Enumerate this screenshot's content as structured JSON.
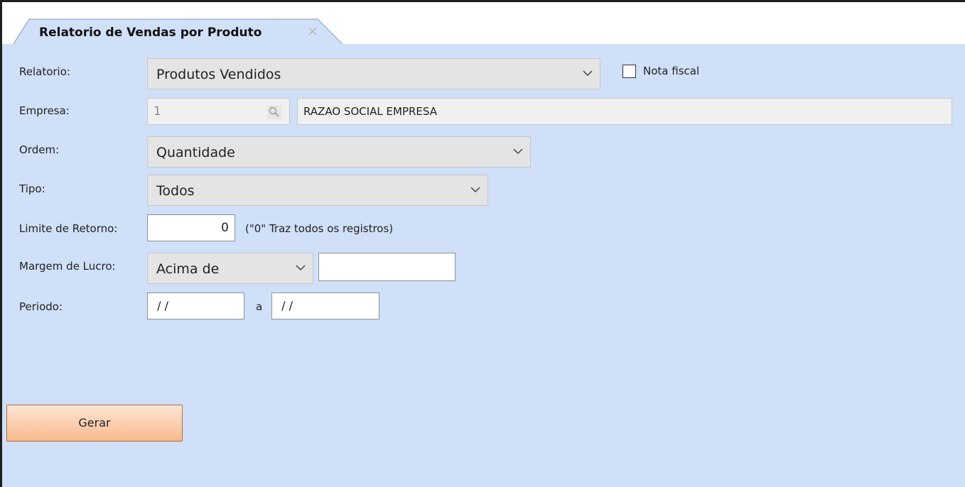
{
  "tab": {
    "title": "Relatorio de Vendas por Produto",
    "close": "×"
  },
  "form": {
    "relatorio": {
      "label": "Relatorio:",
      "value": "Produtos Vendidos"
    },
    "nota_fiscal": {
      "label": "Nota fiscal",
      "checked": false
    },
    "empresa": {
      "label": "Empresa:",
      "code": "1",
      "name": "RAZAO SOCIAL EMPRESA"
    },
    "ordem": {
      "label": "Ordem:",
      "value": "Quantidade"
    },
    "tipo": {
      "label": "Tipo:",
      "value": "Todos"
    },
    "limite": {
      "label": "Limite de Retorno:",
      "value": "0",
      "hint": "(\"0\" Traz todos os registros)"
    },
    "margem": {
      "label": "Margem de Lucro:",
      "value": "Acima de",
      "amount": ""
    },
    "periodo": {
      "label": "Periodo:",
      "start": " / /",
      "separator": "a",
      "end": " / /"
    }
  },
  "actions": {
    "gerar": "Gerar"
  },
  "colors": {
    "background": "#cfe0f8",
    "button": "#f9b98f",
    "frame": "#1f1f1f"
  },
  "icons": {
    "search": "magnifier-icon",
    "dropdown": "chevron-down-icon",
    "close": "close-icon"
  }
}
